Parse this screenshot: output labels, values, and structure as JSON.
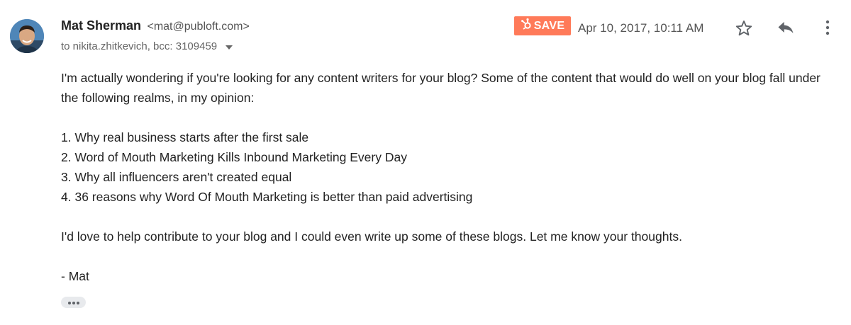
{
  "email": {
    "sender_name": "Mat Sherman",
    "sender_email": "<mat@publoft.com>",
    "recipients": "to nikita.zhitkevich, bcc: 3109459",
    "save_label": "SAVE",
    "timestamp": "Apr 10, 2017, 10:11 AM",
    "body": {
      "intro": "I'm actually wondering if you're looking for any content writers for your blog? Some of the content that would do well on your blog fall under the following realms, in my opinion:",
      "list": [
        "1. Why real business starts after the first sale",
        "2. Word of Mouth Marketing Kills Inbound Marketing Every Day",
        "3. Why all influencers aren't created equal",
        "4. 36 reasons why Word Of Mouth Marketing is better than paid advertising"
      ],
      "closing": "I'd love to help contribute to your blog and I could even write up some of these blogs. Let me know your thoughts.",
      "signature": "- Mat"
    }
  },
  "icons": {
    "avatar": "avatar-photo",
    "save": "hubspot-sprocket-icon",
    "star": "star-outline-icon",
    "reply": "reply-arrow-icon",
    "more": "vertical-dots-icon",
    "recipients_toggle": "caret-down-icon",
    "expand": "ellipsis-icon"
  },
  "colors": {
    "save_bg": "#ff7a59",
    "text": "#222222",
    "muted": "#666666",
    "icon": "#5f6368"
  }
}
